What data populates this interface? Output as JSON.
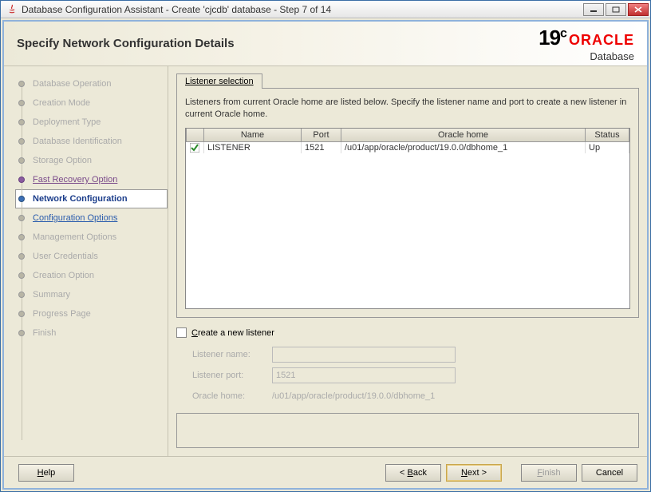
{
  "window": {
    "title": "Database Configuration Assistant - Create 'cjcdb' database - Step 7 of 14"
  },
  "header": {
    "title": "Specify Network Configuration Details",
    "logo_version": "19",
    "logo_c": "c",
    "logo_brand": "ORACLE",
    "logo_product": "Database"
  },
  "sidebar": {
    "items": [
      {
        "label": "Database Operation",
        "state": "disabled"
      },
      {
        "label": "Creation Mode",
        "state": "disabled"
      },
      {
        "label": "Deployment Type",
        "state": "disabled"
      },
      {
        "label": "Database Identification",
        "state": "disabled"
      },
      {
        "label": "Storage Option",
        "state": "disabled"
      },
      {
        "label": "Fast Recovery Option",
        "state": "done"
      },
      {
        "label": "Network Configuration",
        "state": "active"
      },
      {
        "label": "Configuration Options",
        "state": "next"
      },
      {
        "label": "Management Options",
        "state": "disabled"
      },
      {
        "label": "User Credentials",
        "state": "disabled"
      },
      {
        "label": "Creation Option",
        "state": "disabled"
      },
      {
        "label": "Summary",
        "state": "disabled"
      },
      {
        "label": "Progress Page",
        "state": "disabled"
      },
      {
        "label": "Finish",
        "state": "disabled"
      }
    ]
  },
  "tab": {
    "label": "Listener selection",
    "description": "Listeners from current Oracle home are listed below. Specify the listener name and port to create a new listener in current Oracle home."
  },
  "table": {
    "columns": {
      "check": "",
      "name": "Name",
      "port": "Port",
      "home": "Oracle home",
      "status": "Status"
    },
    "rows": [
      {
        "checked": true,
        "name": "LISTENER",
        "port": "1521",
        "home": "/u01/app/oracle/product/19.0.0/dbhome_1",
        "status": "Up"
      }
    ]
  },
  "newListener": {
    "checkbox_label": "Create a new listener",
    "name_label": "Listener name:",
    "name_value": "",
    "port_label": "Listener port:",
    "port_value": "1521",
    "home_label": "Oracle home:",
    "home_value": "/u01/app/oracle/product/19.0.0/dbhome_1"
  },
  "buttons": {
    "help": "Help",
    "back": "< Back",
    "next": "Next >",
    "finish": "Finish",
    "cancel": "Cancel"
  }
}
